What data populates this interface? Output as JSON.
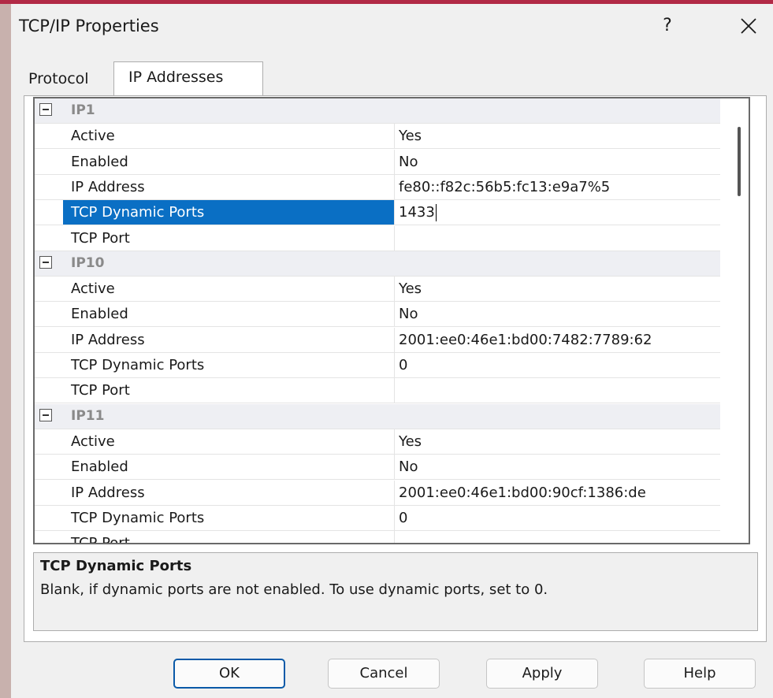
{
  "window": {
    "title": "TCP/IP Properties",
    "help_glyph": "?"
  },
  "tabs": [
    {
      "label": "Protocol"
    },
    {
      "label": "IP Addresses"
    }
  ],
  "groups": [
    {
      "name": "IP1",
      "properties": [
        {
          "name": "Active",
          "value": "Yes"
        },
        {
          "name": "Enabled",
          "value": "No"
        },
        {
          "name": "IP Address",
          "value": "fe80::f82c:56b5:fc13:e9a7%5"
        },
        {
          "name": "TCP Dynamic Ports",
          "value": "1433"
        },
        {
          "name": "TCP Port",
          "value": ""
        }
      ]
    },
    {
      "name": "IP10",
      "properties": [
        {
          "name": "Active",
          "value": "Yes"
        },
        {
          "name": "Enabled",
          "value": "No"
        },
        {
          "name": "IP Address",
          "value": "2001:ee0:46e1:bd00:7482:7789:62"
        },
        {
          "name": "TCP Dynamic Ports",
          "value": "0"
        },
        {
          "name": "TCP Port",
          "value": ""
        }
      ]
    },
    {
      "name": "IP11",
      "properties": [
        {
          "name": "Active",
          "value": "Yes"
        },
        {
          "name": "Enabled",
          "value": "No"
        },
        {
          "name": "IP Address",
          "value": "2001:ee0:46e1:bd00:90cf:1386:de"
        },
        {
          "name": "TCP Dynamic Ports",
          "value": "0"
        },
        {
          "name": "TCP Port",
          "value": ""
        }
      ]
    }
  ],
  "description": {
    "title": "TCP Dynamic Ports",
    "text": "Blank, if dynamic ports are not enabled. To use dynamic ports, set to 0."
  },
  "buttons": {
    "ok": "OK",
    "cancel": "Cancel",
    "apply": "Apply",
    "help": "Help"
  },
  "colors": {
    "selection": "#0a6fc4",
    "accent": "#b22a46",
    "default_button_border": "#0a5aa8"
  },
  "icons": {
    "close": "close-icon",
    "collapse": "collapse-icon"
  }
}
